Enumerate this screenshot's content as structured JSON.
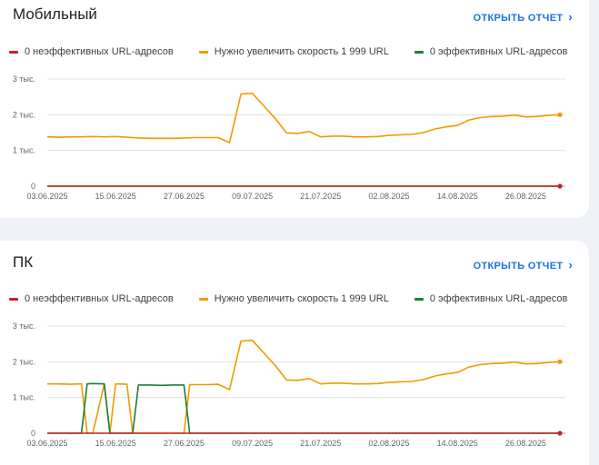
{
  "colors": {
    "poor": "#c5221f",
    "improve": "#f29900",
    "good": "#188038",
    "link": "#1a73e8"
  },
  "cards": [
    {
      "title": "Мобильный",
      "open_label": "ОТКРЫТЬ ОТЧЕТ",
      "legend": [
        {
          "label": "0 неэффективных URL-адресов"
        },
        {
          "label": "Нужно увеличить скорость 1 999 URL"
        },
        {
          "label": "0 эффективных URL-адресов"
        }
      ]
    },
    {
      "title": "ПК",
      "open_label": "ОТКРЫТЬ ОТЧЕТ",
      "legend": [
        {
          "label": "0 неэффективных URL-адресов"
        },
        {
          "label": "Нужно увеличить скорость 1 999 URL"
        },
        {
          "label": "0 эффективных URL-адресов"
        }
      ]
    }
  ],
  "chart_data": [
    {
      "type": "line",
      "y_ticks": [
        "0",
        "1 тыс.",
        "2 тыс.",
        "3 тыс."
      ],
      "x_ticks": [
        "03.06.2025",
        "15.06.2025",
        "27.06.2025",
        "09.07.2025",
        "21.07.2025",
        "02.08.2025",
        "14.08.2025",
        "26.08.2025"
      ],
      "x": [
        "03.06",
        "05.06",
        "07.06",
        "09.06",
        "11.06",
        "13.06",
        "15.06",
        "17.06",
        "19.06",
        "21.06",
        "23.06",
        "25.06",
        "27.06",
        "29.06",
        "01.07",
        "03.07",
        "05.07",
        "07.07",
        "09.07",
        "11.07",
        "13.07",
        "15.07",
        "17.07",
        "19.07",
        "21.07",
        "23.07",
        "25.07",
        "27.07",
        "29.07",
        "31.07",
        "02.08",
        "04.08",
        "06.08",
        "08.08",
        "10.08",
        "12.08",
        "14.08",
        "16.08",
        "18.08",
        "20.08",
        "22.08",
        "24.08",
        "26.08",
        "28.08",
        "30.08",
        "01.09"
      ],
      "ylim": [
        0,
        3000
      ],
      "grid": true,
      "series": [
        {
          "name": "0 неэффективных URL-адресов",
          "values": [
            0,
            0,
            0,
            0,
            0,
            0,
            0,
            0,
            0,
            0,
            0,
            0,
            0,
            0,
            0,
            0,
            0,
            0,
            0,
            0,
            0,
            0,
            0,
            0,
            0,
            0,
            0,
            0,
            0,
            0,
            0,
            0,
            0,
            0,
            0,
            0,
            0,
            0,
            0,
            0,
            0,
            0,
            0,
            0,
            0,
            0
          ]
        },
        {
          "name": "Нужно увеличить скорость 1 999 URL",
          "values": [
            1380,
            1370,
            1380,
            1380,
            1390,
            1380,
            1390,
            1370,
            1350,
            1340,
            1340,
            1340,
            1350,
            1360,
            1360,
            1360,
            1220,
            2580,
            2600,
            2250,
            1900,
            1490,
            1480,
            1530,
            1380,
            1400,
            1400,
            1380,
            1380,
            1390,
            1420,
            1440,
            1450,
            1500,
            1600,
            1660,
            1700,
            1850,
            1920,
            1950,
            1960,
            1990,
            1940,
            1950,
            1980,
            2000
          ]
        },
        {
          "name": "0 эффективных URL-адресов",
          "values": [
            0,
            0,
            0,
            0,
            0,
            0,
            0,
            0,
            0,
            0,
            0,
            0,
            0,
            0,
            0,
            0,
            0,
            0,
            0,
            0,
            0,
            0,
            0,
            0,
            0,
            0,
            0,
            0,
            0,
            0,
            0,
            0,
            0,
            0,
            0,
            0,
            0,
            0,
            0,
            0,
            0,
            0,
            0,
            0,
            0,
            0
          ]
        }
      ]
    },
    {
      "type": "line",
      "y_ticks": [
        "0",
        "1 тыс.",
        "2 тыс.",
        "3 тыс."
      ],
      "x_ticks": [
        "03.06.2025",
        "15.06.2025",
        "27.06.2025",
        "09.07.2025",
        "21.07.2025",
        "02.08.2025",
        "14.08.2025",
        "26.08.2025"
      ],
      "x": [
        "03.06",
        "05.06",
        "07.06",
        "09.06",
        "10.06",
        "11.06",
        "13.06",
        "14.06",
        "15.06",
        "17.06",
        "18.06",
        "19.06",
        "21.06",
        "23.06",
        "25.06",
        "27.06",
        "28.06",
        "29.06",
        "01.07",
        "03.07",
        "05.07",
        "07.07",
        "09.07",
        "11.07",
        "13.07",
        "15.07",
        "17.07",
        "19.07",
        "21.07",
        "23.07",
        "25.07",
        "27.07",
        "29.07",
        "31.07",
        "02.08",
        "04.08",
        "06.08",
        "08.08",
        "10.08",
        "12.08",
        "14.08",
        "16.08",
        "18.08",
        "20.08",
        "22.08",
        "24.08",
        "26.08",
        "28.08",
        "30.08",
        "01.09"
      ],
      "ylim": [
        0,
        3000
      ],
      "grid": true,
      "series": [
        {
          "name": "0 неэффективных URL-адресов",
          "values": [
            0,
            0,
            0,
            0,
            0,
            0,
            0,
            0,
            0,
            0,
            0,
            0,
            0,
            0,
            0,
            0,
            0,
            0,
            0,
            0,
            0,
            0,
            0,
            0,
            0,
            0,
            0,
            0,
            0,
            0,
            0,
            0,
            0,
            0,
            0,
            0,
            0,
            0,
            0,
            0,
            0,
            0,
            0,
            0,
            0,
            0,
            0,
            0,
            0,
            0
          ]
        },
        {
          "name": "Нужно увеличить скорость 1 999 URL",
          "values": [
            1380,
            1380,
            1370,
            1380,
            0,
            0,
            1380,
            0,
            1380,
            1370,
            0,
            0,
            0,
            0,
            0,
            0,
            1360,
            1360,
            1360,
            1370,
            1220,
            2580,
            2600,
            2250,
            1900,
            1490,
            1480,
            1530,
            1380,
            1400,
            1400,
            1380,
            1380,
            1390,
            1420,
            1440,
            1450,
            1500,
            1600,
            1660,
            1700,
            1850,
            1920,
            1950,
            1960,
            1990,
            1940,
            1950,
            1980,
            2000
          ]
        },
        {
          "name": "0 эффективных URL-адресов",
          "values": [
            0,
            0,
            0,
            0,
            1380,
            1390,
            1380,
            0,
            0,
            0,
            0,
            1350,
            1350,
            1340,
            1350,
            1350,
            0,
            0,
            0,
            0,
            0,
            0,
            0,
            0,
            0,
            0,
            0,
            0,
            0,
            0,
            0,
            0,
            0,
            0,
            0,
            0,
            0,
            0,
            0,
            0,
            0,
            0,
            0,
            0,
            0,
            0,
            0,
            0,
            0,
            0
          ]
        }
      ]
    }
  ]
}
